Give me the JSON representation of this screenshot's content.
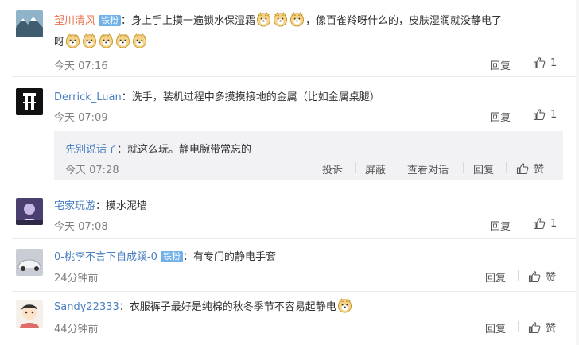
{
  "comments": [
    {
      "username": "望川清风",
      "badge": "铁粉",
      "text_line1": "身上手上摸一遍锁水保湿霜",
      "text_line1b": "，像百雀羚呀什么的，皮肤湿润就没静电了",
      "text_line2": "呀",
      "time": "今天 07:16",
      "reply_label": "回复",
      "like_count": "1"
    },
    {
      "username": "Derrick_Luan",
      "text": "洗手，装机过程中多摸摸接地的金属（比如金属桌腿）",
      "time": "今天 07:09",
      "reply_label": "回复",
      "like_count": "1",
      "sub_reply": {
        "username": "先别说话了",
        "text": "就这么玩。静电腕带常忘的",
        "time": "今天 07:28",
        "actions": [
          "投诉",
          "屏蔽",
          "查看对话",
          "回复"
        ],
        "like_label": "赞"
      }
    },
    {
      "username": "宅家玩游",
      "text": "摸水泥墙",
      "time": "今天 07:08",
      "reply_label": "回复",
      "like_count": "1"
    },
    {
      "username": "0-桃李不言下自成蹊-0",
      "badge": "铁粉",
      "text": "有专门的静电手套",
      "time": "24分钟前",
      "reply_label": "回复",
      "like_label": "赞"
    },
    {
      "username": "Sandy22333",
      "text": "衣服裤子最好是纯棉的秋冬季节不容易起静电",
      "time": "44分钟前",
      "reply_label": "回复",
      "like_label": "赞"
    }
  ],
  "colors": {
    "username_orange": "#eb7350",
    "username_blue": "#4a7fc1",
    "badge_bg": "#6fb1e8",
    "reply_box_bg": "#f2f2f5"
  },
  "icons": [
    "emoji-doge-icon",
    "thumbs-up-icon"
  ]
}
